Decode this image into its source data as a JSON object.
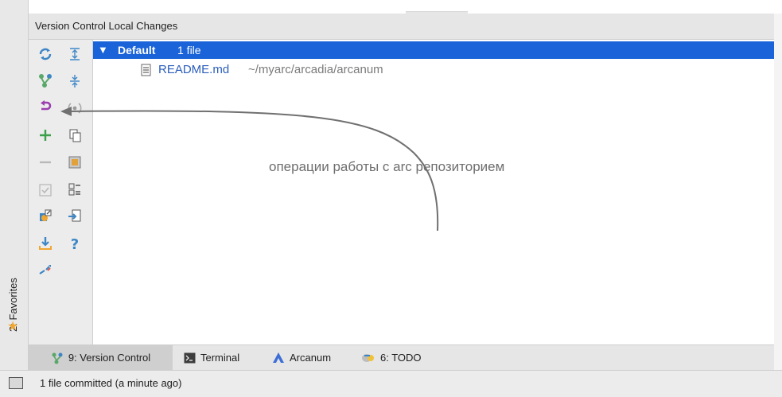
{
  "panel": {
    "title": "Version Control Local Changes"
  },
  "favorites": {
    "label": "2: Favorites",
    "icon": "star-icon"
  },
  "toolbar": {
    "left": [
      "refresh-icon",
      "branch-icon",
      "rollback-icon",
      "add-icon",
      "remove-icon",
      "checkbox-icon",
      "diff-icon",
      "update-icon",
      "merge-icon"
    ],
    "right": [
      "expand-all-icon",
      "collapse-all-icon",
      "sync-icon",
      "copy-icon",
      "shelf-icon",
      "group-by-icon",
      "import-icon",
      "help-icon"
    ]
  },
  "changelist": {
    "name": "Default",
    "count": "1 file",
    "files": [
      {
        "name": "README.md",
        "path": "~/myarc/arcadia/arcanum"
      }
    ]
  },
  "annotation": {
    "text": "операции работы с arc репозиторием"
  },
  "bottom_tabs": {
    "vcs": "9: Version Control",
    "terminal": "Terminal",
    "arcanum": "Arcanum",
    "todo": "6: TODO"
  },
  "status": {
    "text": "1 file committed (a minute ago)"
  },
  "colors": {
    "selection": "#1a63d9",
    "file_link": "#2a5dbb",
    "accent_star": "#f0a732"
  }
}
